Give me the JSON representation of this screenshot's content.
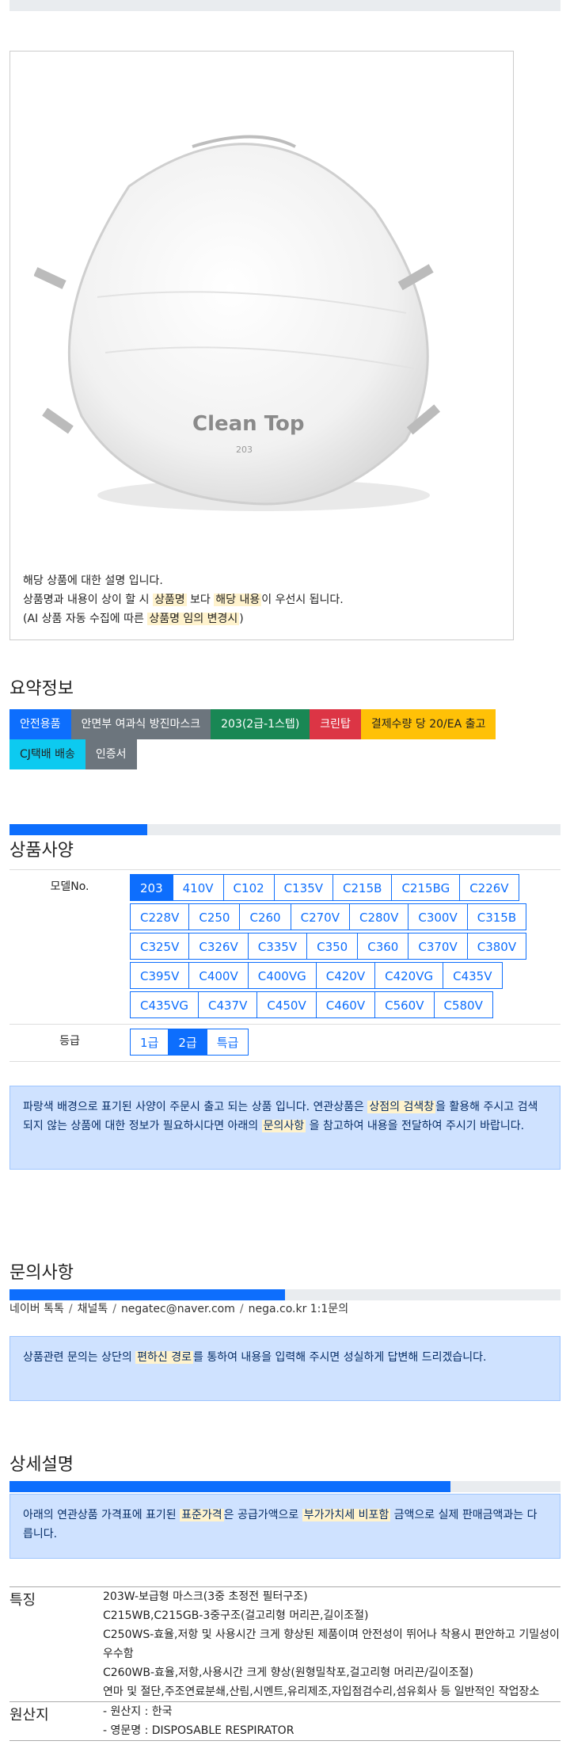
{
  "product_image": {
    "desc_line1": "해당 상품에 대한 설명 입니다.",
    "desc_line2_a": "상품명과 내용이 상이 할 시 ",
    "desc_line2_hl1": "상품명",
    "desc_line2_b": " 보다 ",
    "desc_line2_hl2": "해당 내용",
    "desc_line2_c": "이 우선시 됩니다.",
    "desc_line3_a": "(AI 상품 자동 수집에 따른 ",
    "desc_line3_hl": "상품명 임의 변경시",
    "desc_line3_b": ")",
    "mask_brand": "Clean Top",
    "mask_model": "203"
  },
  "summary": {
    "title": "요약정보",
    "badges": [
      "안전용품",
      "안면부 여과식 방진마스크",
      "203(2급-1스텝)",
      "크린탑",
      "결제수량 당 20/EA 출고",
      "CJ택배 배송",
      "인증서"
    ]
  },
  "spec": {
    "title": "상품사양",
    "progress": 0.25,
    "model_label": "모델No.",
    "models": [
      "203",
      "410V",
      "C102",
      "C135V",
      "C215B",
      "C215BG",
      "C226V",
      "C228V",
      "C250",
      "C260",
      "C270V",
      "C280V",
      "C300V",
      "C315B",
      "C325V",
      "C326V",
      "C335V",
      "C350",
      "C360",
      "C370V",
      "C380V",
      "C395V",
      "C400V",
      "C400VG",
      "C420V",
      "C420VG",
      "C435V",
      "C435VG",
      "C437V",
      "C450V",
      "C460V",
      "C560V",
      "C580V"
    ],
    "model_selected": "203",
    "grade_label": "등급",
    "grades": [
      "1급",
      "2급",
      "특급"
    ],
    "grade_selected": "2급",
    "notice_a": "파랑색 배경으로 표기된 사양이 주문시 출고 되는 상품 입니다. 연관상품은 ",
    "notice_hl1": "상점의 검색창",
    "notice_b": "을 활용해 주시고 검색되지 않는 상품에 대한 정보가 필요하시다면 아래의 ",
    "notice_hl2": "문의사항",
    "notice_c": " 을 참고하여 내용을 전달하여 주시기 바랍니다."
  },
  "inquiry": {
    "title": "문의사항",
    "progress": 0.5,
    "contacts": [
      "네이버 톡톡",
      "채널톡",
      "negatec@naver.com",
      "nega.co.kr 1:1문의"
    ],
    "notice_a": "상품관련 문의는 상단의 ",
    "notice_hl": "편하신 경로",
    "notice_b": "를 통하여 내용을 입력해 주시면 성실하게 답변해 드리겠습니다."
  },
  "detail": {
    "title": "상세설명",
    "progress": 0.8,
    "notice_a": "아래의 연관상품 가격표에 표기된 ",
    "notice_hl1": "표준가격",
    "notice_b": "은 공급가액으로 ",
    "notice_hl2": "부가가치세 비포함",
    "notice_c": " 금액으로 실제 판매금액과는 다릅니다.",
    "feature_label": "특징",
    "features": [
      "203W-보급형 마스크(3중 초정전 필터구조)",
      "C215WB,C215GB-3중구조(걸고리형 머리끈,길이조절)",
      "C250WS-효율,저항 및 사용시간 크게 향상된 제품이며 안전성이 뛰어나 착용시 편안하고 기밀성이 우수함",
      "C260WB-효율,저항,사용시간 크게 향상(원형밀착포,걸고리형 머리끈/길이조절)",
      "연마 및 절단,주조연료분쇄,산림,시멘트,유리제조,자입점검수리,섬유회사 등 일반적인 작업장소"
    ],
    "origin_label": "원산지",
    "origin": [
      "- 원산지 : 한국",
      "- 영문명 : DISPOSABLE RESPIRATOR"
    ]
  }
}
